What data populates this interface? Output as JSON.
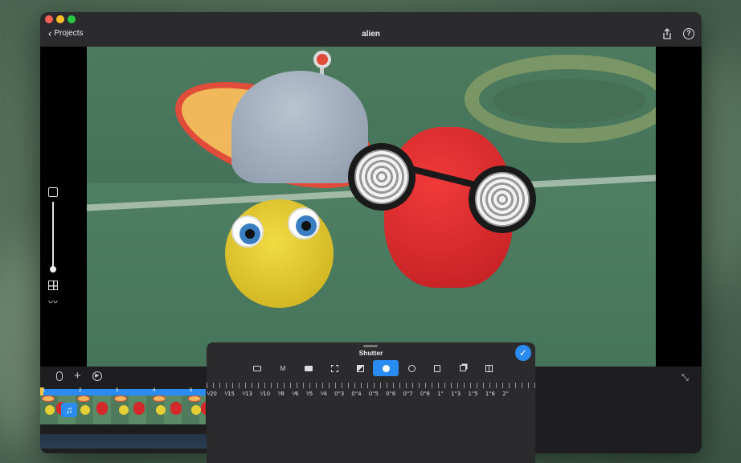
{
  "window": {
    "back_label": "Projects",
    "title": "alien"
  },
  "titlebar_icons": [
    "share-icon",
    "help-icon"
  ],
  "side_tools": [
    "overlay-icon",
    "grid-icon",
    "graph-icon"
  ],
  "bottom_tools": {
    "add_label": "+"
  },
  "timeline": {
    "ruler_numbers": [
      "1",
      "2",
      "3",
      "4",
      "5"
    ]
  },
  "panel": {
    "title": "Shutter",
    "done_icon": "checkmark-icon",
    "modes": [
      {
        "name": "camera-icon",
        "label": ""
      },
      {
        "name": "manual-mode",
        "label": "M"
      },
      {
        "name": "video-icon",
        "label": ""
      },
      {
        "name": "focus-icon",
        "label": ""
      },
      {
        "name": "exposure-icon",
        "label": ""
      },
      {
        "name": "shutter-icon",
        "label": "",
        "active": true
      },
      {
        "name": "zoom-icon",
        "label": ""
      },
      {
        "name": "import-icon",
        "label": ""
      },
      {
        "name": "layers-icon",
        "label": ""
      },
      {
        "name": "split-icon",
        "label": ""
      }
    ],
    "shutter_values": [
      "¹⁄20",
      "¹⁄15",
      "¹⁄13",
      "¹⁄10",
      "¹⁄8",
      "¹⁄6",
      "¹⁄5",
      "¹⁄4",
      "0\"3",
      "0\"4",
      "0\"5",
      "0\"6",
      "0\"7",
      "0\"8",
      "1\"",
      "1\"3",
      "1\"5",
      "1\"6",
      "2\""
    ]
  },
  "colors": {
    "accent": "#2a8cf0",
    "window_bg": "#1c1c1e",
    "titlebar_bg": "#2b2b2d"
  }
}
